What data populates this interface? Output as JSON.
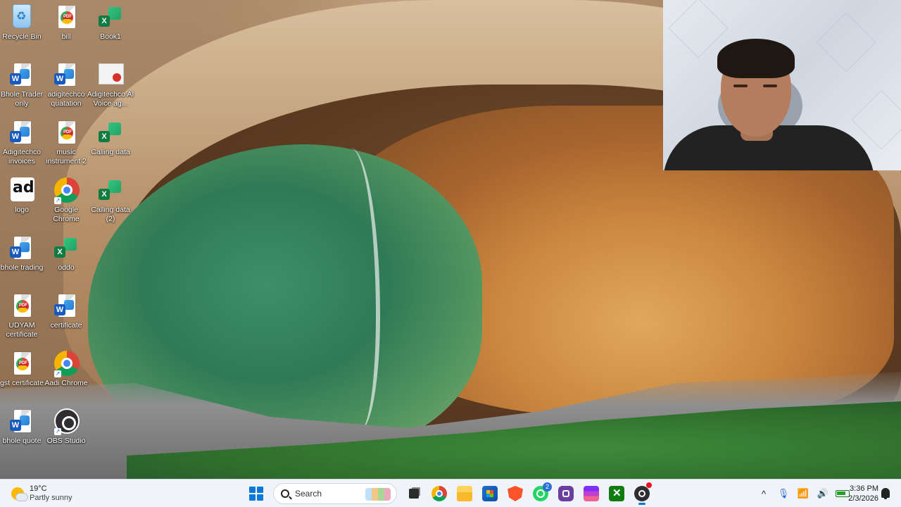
{
  "desktop": {
    "icons": [
      {
        "label": "Recycle Bin",
        "icon": "recycle-bin-icon"
      },
      {
        "label": "bill",
        "icon": "pdf-icon"
      },
      {
        "label": "Book1",
        "icon": "excel-icon"
      },
      {
        "label": "Bhole Trader only",
        "icon": "word-icon"
      },
      {
        "label": "adigitechco quatation",
        "icon": "word-icon"
      },
      {
        "label": "Adigitechco AI Voice ag...",
        "icon": "document-thumbnail-icon"
      },
      {
        "label": "Adigitechco invoices",
        "icon": "word-icon"
      },
      {
        "label": "music instrument 2",
        "icon": "pdf-icon"
      },
      {
        "label": "Calling data",
        "icon": "excel-icon"
      },
      {
        "label": "logo",
        "icon": "ad-logo-icon"
      },
      {
        "label": "Google Chrome",
        "icon": "chrome-icon"
      },
      {
        "label": "Calling data (2)",
        "icon": "excel-icon"
      },
      {
        "label": "bhole trading",
        "icon": "word-icon"
      },
      {
        "label": "oddo",
        "icon": "excel-icon"
      },
      {
        "label": "UDYAM certificate",
        "icon": "pdf-icon"
      },
      {
        "label": "certificate",
        "icon": "word-icon"
      },
      {
        "label": "gst certificate",
        "icon": "pdf-icon"
      },
      {
        "label": "Aadi Chrome",
        "icon": "chrome-icon"
      },
      {
        "label": "bhole quote",
        "icon": "word-icon"
      },
      {
        "label": "OBS Studio",
        "icon": "obs-icon"
      }
    ]
  },
  "taskbar": {
    "weather": {
      "temp": "19°C",
      "condition": "Partly sunny",
      "icon": "partly-sunny-icon"
    },
    "search_label": "Search",
    "whatsapp_badge": "2",
    "apps": [
      "start-icon",
      "task-view-icon",
      "chrome-icon",
      "file-explorer-icon",
      "microsoft-store-icon",
      "brave-icon",
      "whatsapp-icon",
      "copilot-icon",
      "clipchamp-icon",
      "xbox-icon",
      "obs-icon"
    ],
    "tray": {
      "chevron": "^",
      "mic_icon": "microphone-icon",
      "wifi_icon": "wifi-icon",
      "volume_icon": "speaker-icon",
      "battery_icon": "battery-icon"
    },
    "time": "3:36 PM",
    "date": "2/3/2026"
  },
  "colors": {
    "accent": "#0a78d7",
    "taskbar_bg": "#f0f3f7"
  }
}
